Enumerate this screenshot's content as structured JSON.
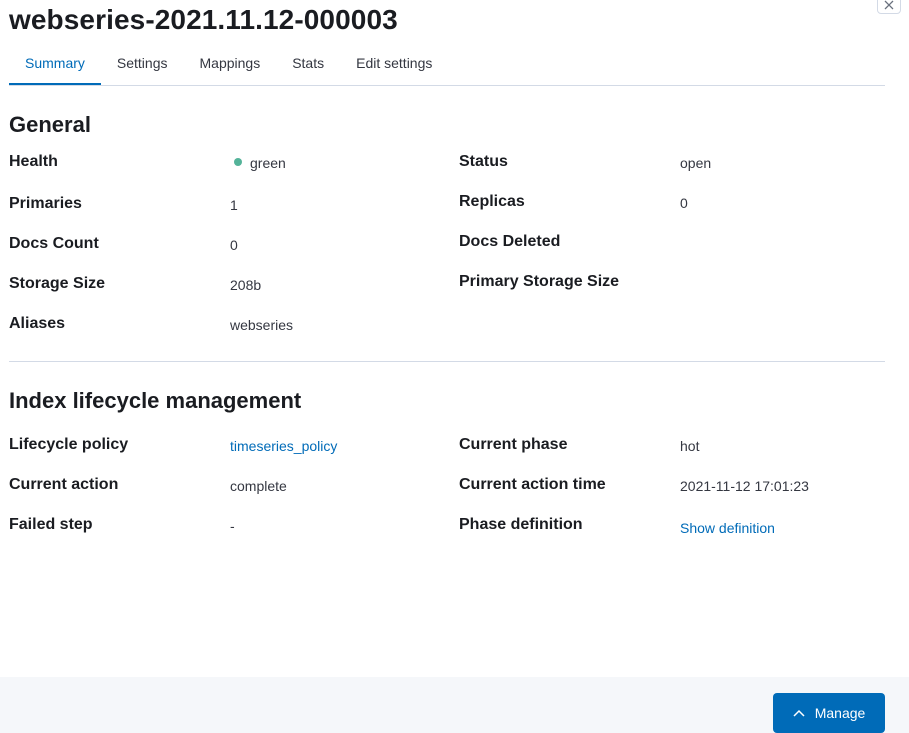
{
  "header": {
    "title": "webseries-2021.11.12-000003",
    "close_icon": "close-icon"
  },
  "tabs": [
    {
      "label": "Summary",
      "selected": true
    },
    {
      "label": "Settings",
      "selected": false
    },
    {
      "label": "Mappings",
      "selected": false
    },
    {
      "label": "Stats",
      "selected": false
    },
    {
      "label": "Edit settings",
      "selected": false
    }
  ],
  "general": {
    "title": "General",
    "health_label": "Health",
    "health_value": "green",
    "health_color": "#54b399",
    "status_label": "Status",
    "status_value": "open",
    "primaries_label": "Primaries",
    "primaries_value": "1",
    "replicas_label": "Replicas",
    "replicas_value": "0",
    "docs_count_label": "Docs Count",
    "docs_count_value": "0",
    "docs_deleted_label": "Docs Deleted",
    "storage_size_label": "Storage Size",
    "storage_size_value": "208b",
    "primary_storage_size_label": "Primary Storage Size",
    "aliases_label": "Aliases",
    "aliases_value": "webseries"
  },
  "ilm": {
    "title": "Index lifecycle management",
    "lifecycle_policy_label": "Lifecycle policy",
    "lifecycle_policy_value": "timeseries_policy",
    "current_phase_label": "Current phase",
    "current_phase_value": "hot",
    "current_action_label": "Current action",
    "current_action_value": "complete",
    "current_action_time_label": "Current action time",
    "current_action_time_value": "2021-11-12 17:01:23",
    "failed_step_label": "Failed step",
    "failed_step_value": "-",
    "phase_definition_label": "Phase definition",
    "phase_definition_link": "Show definition"
  },
  "footer": {
    "manage_label": "Manage",
    "manage_icon": "chevron-up-icon",
    "accent_color": "#006bb8"
  }
}
